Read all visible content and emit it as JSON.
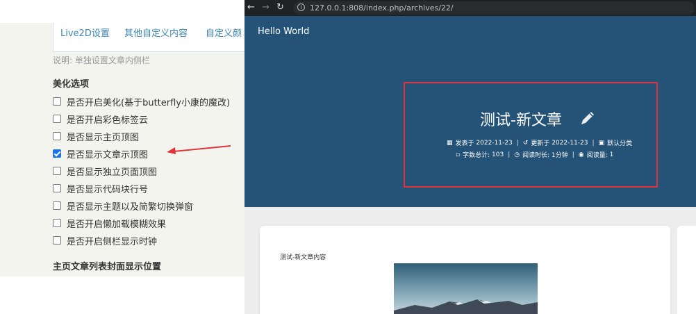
{
  "settings": {
    "tabs": [
      "Live2D设置",
      "其他自定义内容",
      "自定义颜"
    ],
    "note": "说明: 单独设置文章内侧栏",
    "section_title": "美化选项",
    "options": [
      {
        "label": "是否开启美化(基于butterfly小康的魔改)",
        "checked": false
      },
      {
        "label": "是否开启彩色标签云",
        "checked": false
      },
      {
        "label": "是否显示主页顶图",
        "checked": false
      },
      {
        "label": "是否显示文章示顶图",
        "checked": true
      },
      {
        "label": "是否显示独立页面顶图",
        "checked": false
      },
      {
        "label": "是否显示代码块行号",
        "checked": false
      },
      {
        "label": "是否显示主题以及简繁切换弹窗",
        "checked": false
      },
      {
        "label": "是否开启懒加载模糊效果",
        "checked": false
      },
      {
        "label": "是否开启侧栏显示时钟",
        "checked": false
      }
    ],
    "section2_title": "主页文章列表封面显示位置"
  },
  "browser": {
    "url": "127.0.0.1:808/index.php/archives/22/",
    "icons": {
      "back": "arrow-left-icon",
      "forward": "arrow-right-icon",
      "reload": "reload-icon",
      "info": "info-icon"
    }
  },
  "blog": {
    "site_title": "Hello World",
    "post_title": "测试-新文章",
    "published_label": "发表于",
    "published_date": "2022-11-23",
    "updated_label": "更新于",
    "updated_date": "2022-11-23",
    "category": "默认分类",
    "wordcount_label": "字数总计:",
    "wordcount": "103",
    "readtime_label": "阅读时长:",
    "readtime": "1分钟",
    "views_label": "阅读量:",
    "views": "1",
    "content_text": "测试-新文章内容"
  },
  "colors": {
    "header_bg": "#245377",
    "highlight": "#e2333b",
    "link": "#3b86b6",
    "checkbox": "#1a73e8"
  }
}
